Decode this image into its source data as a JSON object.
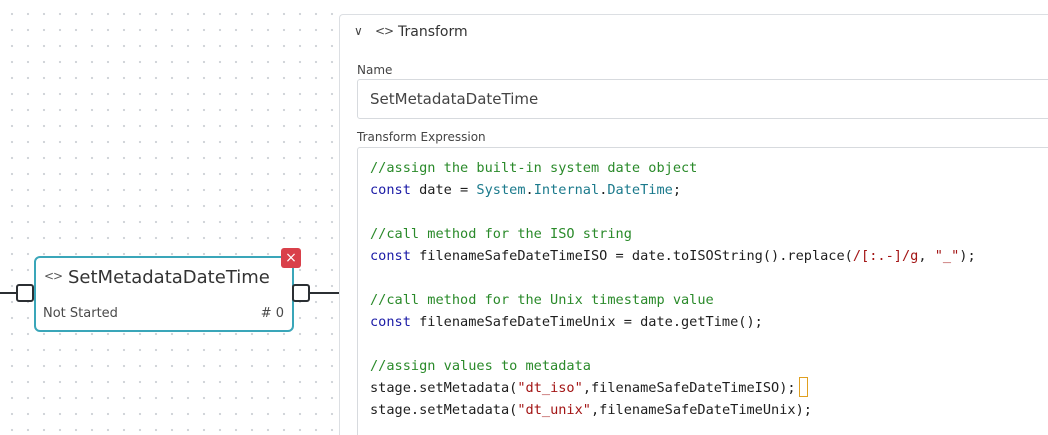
{
  "canvas": {
    "node": {
      "title": "SetMetadataDateTime",
      "status": "Not Started",
      "count": "# 0",
      "icon": "code-icon",
      "delete_glyph": "×"
    }
  },
  "panel": {
    "collapse_glyph": "∨",
    "icon_glyph": "<>",
    "title": "Transform",
    "name_label": "Name",
    "name_value": "SetMetadataDateTime",
    "expression_label": "Transform Expression",
    "code": {
      "l1": "//assign the built-in system date object",
      "l2_kw": "const",
      "l2_a": " date = ",
      "l2_c1": "System",
      "l2_d1": ".",
      "l2_c2": "Internal",
      "l2_d2": ".",
      "l2_c3": "DateTime",
      "l2_end": ";",
      "l4": "//call method for the ISO string",
      "l5_kw": "const",
      "l5_a": " filenameSafeDateTimeISO = date.toISOString().replace(",
      "l5_re": "/[:.-]/g",
      "l5_b": ", ",
      "l5_str": "\"_\"",
      "l5_end": ");",
      "l7": "//call method for the Unix timestamp value",
      "l8_kw": "const",
      "l8_a": " filenameSafeDateTimeUnix = date.getTime();",
      "l10": "//assign values to metadata",
      "l11_a": "stage.setMetadata(",
      "l11_str": "\"dt_iso\"",
      "l11_b": ",filenameSafeDateTimeISO);",
      "l12_a": "stage.setMetadata(",
      "l12_str": "\"dt_unix\"",
      "l12_b": ",filenameSafeDateTimeUnix);"
    }
  },
  "colors": {
    "node_border": "#3aa6b9",
    "delete_bg": "#d9404a",
    "comment": "#2a8a2a",
    "keyword": "#1a1aa6",
    "string": "#a31515"
  }
}
